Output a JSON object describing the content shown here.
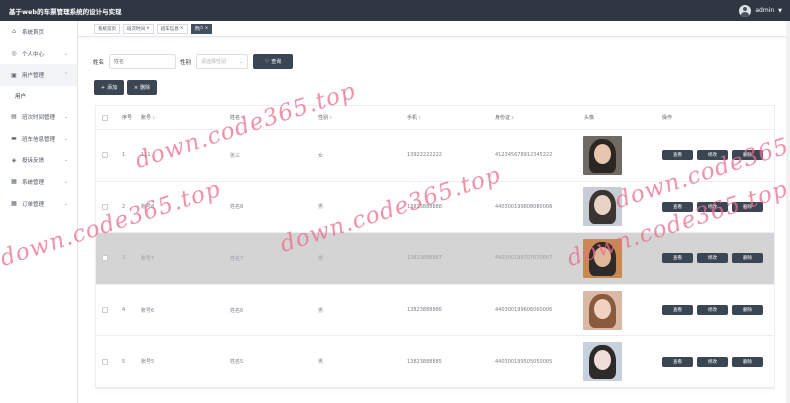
{
  "header": {
    "title": "基于web的车票管理系统的设计与实现",
    "username": "admin"
  },
  "sidebar": {
    "items": [
      {
        "label": "系统首页",
        "icon": "home-icon",
        "glyph": "⌂",
        "chevron": ""
      },
      {
        "label": "个人中心",
        "icon": "user-icon",
        "glyph": "◎",
        "chevron": "⌄"
      },
      {
        "label": "用户管理",
        "icon": "users-icon",
        "glyph": "▣",
        "chevron": "⌃"
      },
      {
        "label": "班次时间管理",
        "icon": "list-icon",
        "glyph": "▤",
        "chevron": "⌄"
      },
      {
        "label": "班车信息管理",
        "icon": "bus-icon",
        "glyph": "▬",
        "chevron": "⌄"
      },
      {
        "label": "投诉反馈",
        "icon": "chat-icon",
        "glyph": "◈",
        "chevron": "⌄"
      },
      {
        "label": "系统管理",
        "icon": "grid-icon",
        "glyph": "▦",
        "chevron": "⌄"
      },
      {
        "label": "订单管理",
        "icon": "order-icon",
        "glyph": "▦",
        "chevron": "⌄"
      }
    ],
    "sub_item": "用户"
  },
  "tabs": [
    {
      "label": "系统首页",
      "close": ""
    },
    {
      "label": "班次时间",
      "close": "×"
    },
    {
      "label": "班车信息",
      "close": "×"
    },
    {
      "label": "用户",
      "close": "×"
    }
  ],
  "search": {
    "name_label": "姓名",
    "name_placeholder": "姓名",
    "gender_label": "性别",
    "gender_placeholder": "请选择性别",
    "query_button": "查询",
    "query_icon": "♡"
  },
  "toolbar": {
    "add_label": "添加",
    "add_icon": "+",
    "delete_label": "删除",
    "delete_icon": "×"
  },
  "table": {
    "columns": [
      "序号",
      "账号",
      "姓名",
      "性别",
      "手机",
      "身份证",
      "头像",
      "操作"
    ],
    "sort_glyph": "⇕",
    "rows": [
      {
        "index": "1",
        "account": "111",
        "name": "张三",
        "gender": "女",
        "phone": "13922222222",
        "id_card": "412345678912345222",
        "photo_colors": [
          "#2b2622",
          "#e7c6ae",
          "#6f6a64"
        ]
      },
      {
        "index": "2",
        "account": "账号8",
        "name": "姓名8",
        "gender": "男",
        "phone": "13823888888",
        "id_card": "440300199808080008",
        "photo_colors": [
          "#3a3530",
          "#e9d3c4",
          "#c8ccd4"
        ]
      },
      {
        "index": "3",
        "account": "账号7",
        "name": "姓名7",
        "gender": "男",
        "phone": "13823888887",
        "id_card": "440300199707070007",
        "photo_colors": [
          "#2e2a27",
          "#dfb89a",
          "#c98a52"
        ]
      },
      {
        "index": "4",
        "account": "账号6",
        "name": "姓名6",
        "gender": "男",
        "phone": "13823888886",
        "id_card": "440300199606060006",
        "photo_colors": [
          "#8a5a3c",
          "#f0d2c2",
          "#d9b8a6"
        ]
      },
      {
        "index": "5",
        "account": "账号5",
        "name": "姓名5",
        "gender": "男",
        "phone": "13823888885",
        "id_card": "440300199505050005",
        "photo_colors": [
          "#2d2a2a",
          "#efdfd8",
          "#c7d0dd"
        ]
      }
    ],
    "view_label": "查看",
    "edit_label": "修改",
    "delete_label": "删除"
  },
  "watermarks": [
    "down.code365.top",
    "down.code365.top",
    "down.code365.top",
    "down.code365.top",
    "down.code365.top"
  ]
}
